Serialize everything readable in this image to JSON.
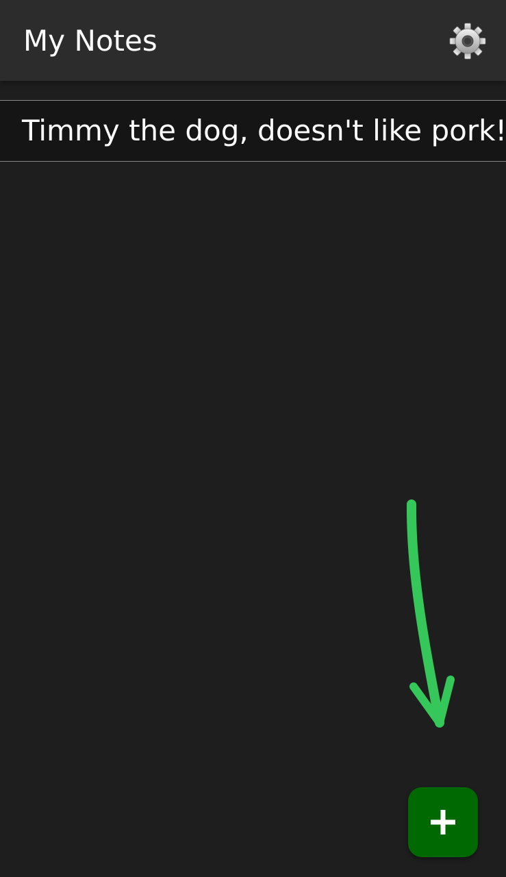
{
  "app_bar": {
    "title": "My Notes",
    "settings_icon": "gear-icon"
  },
  "notes": [
    {
      "text": "Timmy the dog, doesn't like pork!"
    }
  ],
  "fab": {
    "icon": "plus-icon",
    "color": "#016901"
  },
  "annotation": {
    "icon": "arrow-down-icon",
    "color": "#35c759"
  },
  "colors": {
    "background": "#1e1e1e",
    "app_bar": "#2c2c2c",
    "note_item": "#151515"
  }
}
